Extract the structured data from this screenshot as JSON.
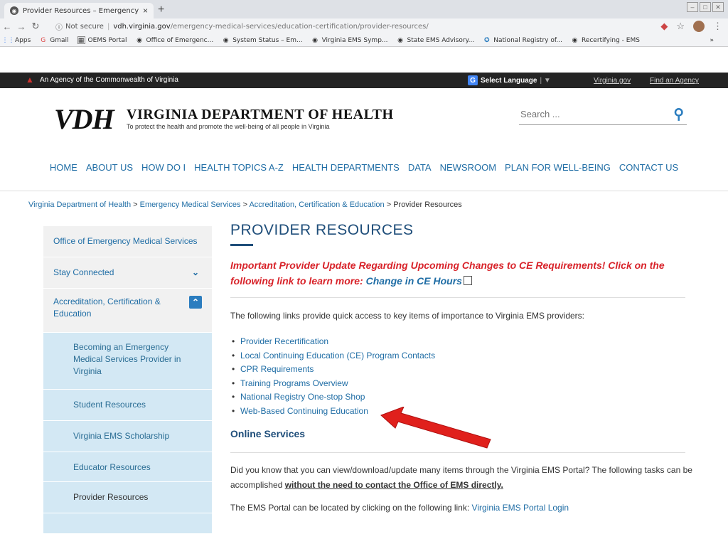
{
  "browser": {
    "tab_title": "Provider Resources – Emergency",
    "tab_close": "×",
    "new_tab": "+",
    "url_prefix": "Not secure",
    "url_domain": "vdh.virginia.gov",
    "url_path": "/emergency-medical-services/education-certification/provider-resources/"
  },
  "bookmarks": [
    {
      "label": "Apps",
      "icon": "apps-icon"
    },
    {
      "label": "Gmail",
      "icon": "gmail-icon"
    },
    {
      "label": "OEMS Portal",
      "icon": "portal-icon"
    },
    {
      "label": "Office of Emergenc...",
      "icon": "globe-icon"
    },
    {
      "label": "System Status – Em...",
      "icon": "globe-icon"
    },
    {
      "label": "Virginia EMS Symp...",
      "icon": "globe-icon"
    },
    {
      "label": "State EMS Advisory...",
      "icon": "globe-icon"
    },
    {
      "label": "National Registry of...",
      "icon": "registry-icon"
    },
    {
      "label": "Recertifying - EMS",
      "icon": "globe-icon"
    }
  ],
  "agency_bar": {
    "name": "An Agency of the Commonwealth of Virginia",
    "select_language": "Select Language",
    "link_virginia": "Virginia.gov",
    "link_find": "Find an Agency"
  },
  "header": {
    "logo_mark": "VDH",
    "title": "VIRGINIA DEPARTMENT OF HEALTH",
    "subtitle": "To protect the health and promote the well-being of all people in Virginia",
    "search_placeholder": "Search ..."
  },
  "main_nav": [
    "HOME",
    "ABOUT US",
    "HOW DO I",
    "HEALTH TOPICS A-Z",
    "HEALTH DEPARTMENTS",
    "DATA",
    "NEWSROOM",
    "PLAN FOR WELL-BEING",
    "CONTACT US"
  ],
  "breadcrumb": {
    "items": [
      "Virginia Department of Health",
      "Emergency Medical Services",
      "Accreditation, Certification & Education"
    ],
    "current": "Provider Resources",
    "separator": ">"
  },
  "sidebar": {
    "top_items": [
      {
        "label": "Office of Emergency Medical Services"
      },
      {
        "label": "Stay Connected"
      },
      {
        "label": "Accreditation, Certification & Education"
      }
    ],
    "sub_items": [
      {
        "label": "Becoming an Emergency Medical Services Provider in Virginia"
      },
      {
        "label": "Student Resources"
      },
      {
        "label": "Virginia EMS Scholarship"
      },
      {
        "label": "Educator Resources"
      },
      {
        "label": "Provider Resources"
      }
    ]
  },
  "content": {
    "title": "PROVIDER RESOURCES",
    "notice_text": "Important Provider Update Regarding Upcoming Changes to CE Requirements! Click on the following link to learn more:",
    "notice_link": "Change in CE Hours",
    "intro": "The following links provide quick access to key items of importance to Virginia EMS providers:",
    "links": [
      "Provider Recertification",
      "Local Continuing Education (CE) Program Contacts",
      "CPR Requirements",
      "Training Programs Overview",
      "National Registry One-stop Shop",
      "Web-Based Continuing Education"
    ],
    "online_title": "Online Services",
    "portal_text_1": "Did you know that you can view/download/update many items through the Virginia EMS Portal?  The following tasks can be accomplished",
    "portal_text_em": "without the need to contact the Office of EMS directly.",
    "portal_cut_text": "The EMS Portal can be located by clicking on the following link:",
    "portal_cut_link": "Virginia EMS Portal Login"
  },
  "colors": {
    "accent": "#1f6da5",
    "alert": "#d8232a",
    "sidebar_sub_bg": "#d3e8f4",
    "arrow": "#e0201c"
  }
}
